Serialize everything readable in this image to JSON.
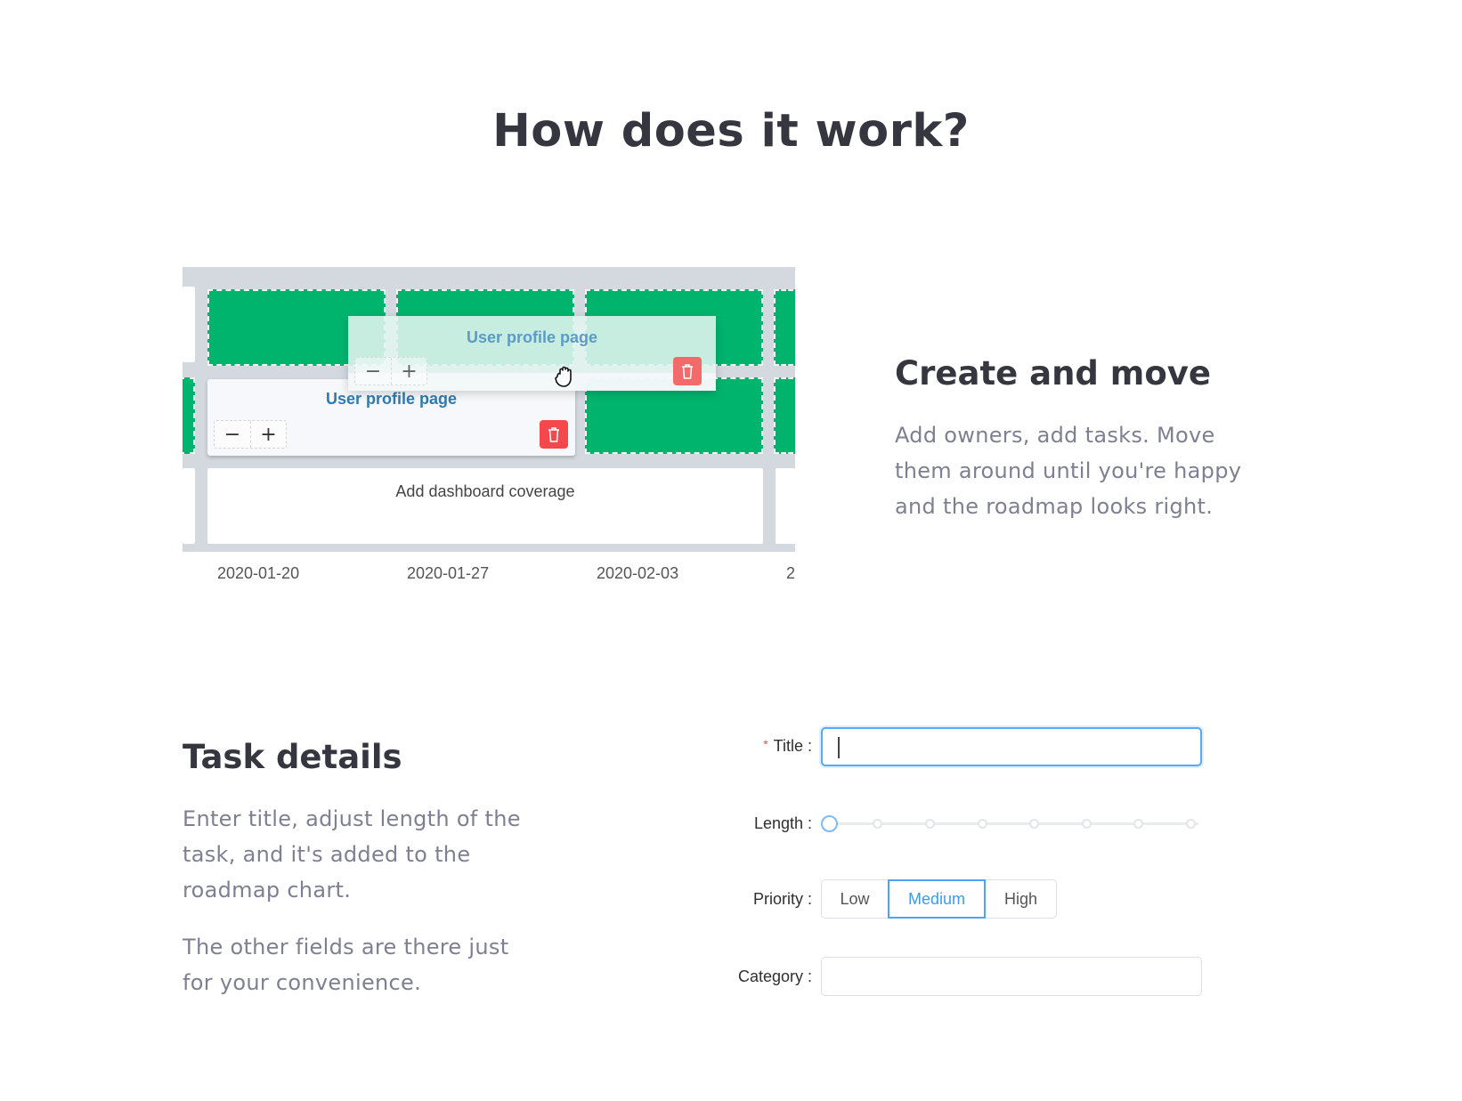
{
  "heading": "How does it work?",
  "roadmap": {
    "dragged_task": {
      "title": "User profile page"
    },
    "task": {
      "title": "User profile page"
    },
    "other_task": {
      "title": "Add dashboard coverage"
    },
    "stepper": {
      "minus": "−",
      "plus": "+"
    },
    "dates": [
      "2020-01-20",
      "2020-01-27",
      "2020-02-03",
      "2"
    ],
    "colors": {
      "cell_green": "#00b46e",
      "background": "#d3d9df",
      "delete": "#f5484d",
      "task_title": "#2f7bb0"
    }
  },
  "create_move": {
    "title": "Create and move",
    "body": [
      "Add owners, add tasks. Move",
      "them around until you're happy",
      "and the roadmap looks right."
    ]
  },
  "task_details": {
    "title": "Task details",
    "body1": [
      "Enter title, adjust length of the",
      "task, and it's added to the",
      "roadmap chart."
    ],
    "body2": [
      "The other fields are there just",
      "for your convenience."
    ]
  },
  "form": {
    "title": {
      "required_mark": "*",
      "label": "Title :",
      "value": ""
    },
    "length": {
      "label": "Length :",
      "steps": 8,
      "value_step": 1
    },
    "priority": {
      "label": "Priority :",
      "options": [
        "Low",
        "Medium",
        "High"
      ],
      "selected": "Medium"
    },
    "category": {
      "label": "Category :",
      "value": ""
    },
    "colors": {
      "focus": "#5aa9f5",
      "required": "#f5484d"
    }
  }
}
